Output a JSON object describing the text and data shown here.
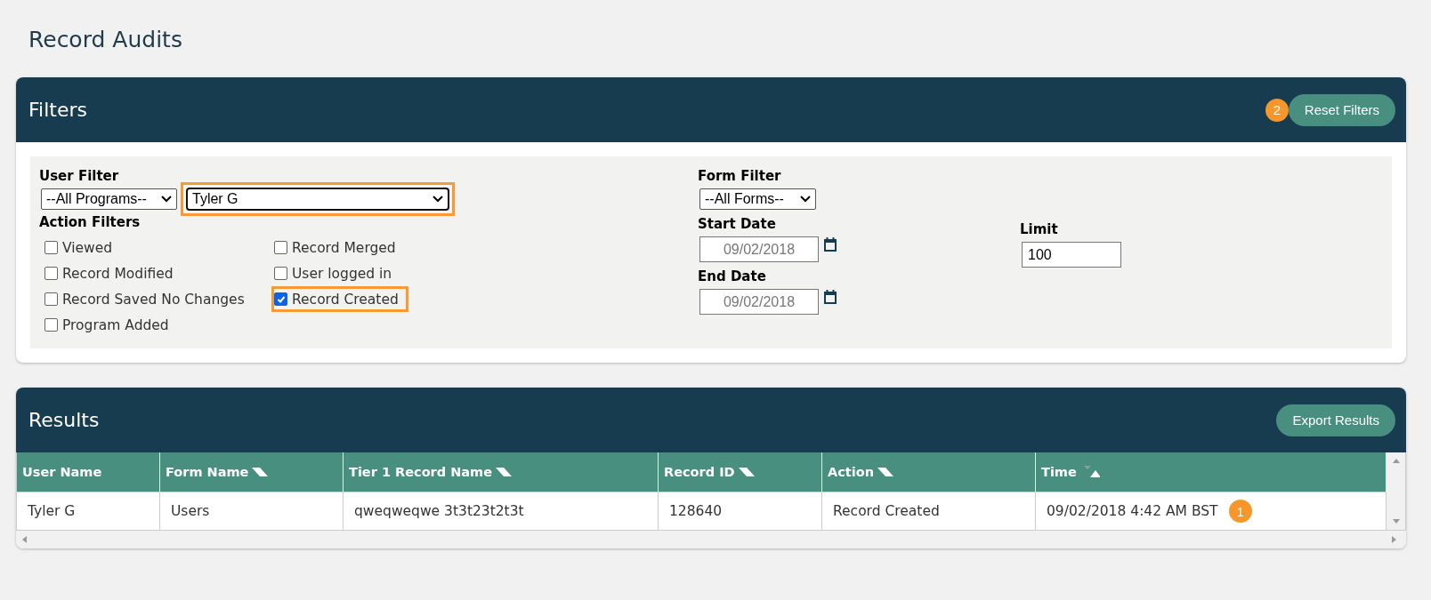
{
  "page_title": "Record Audits",
  "filters": {
    "title": "Filters",
    "badge": "2",
    "reset_button": "Reset Filters",
    "user_filter": {
      "label": "User Filter",
      "program_select": "--All Programs--",
      "user_select": "Tyler G",
      "user_highlighted": true
    },
    "action_filters": {
      "label": "Action Filters",
      "items": [
        {
          "label": "Viewed",
          "checked": false,
          "highlighted": false
        },
        {
          "label": "Record Modified",
          "checked": false,
          "highlighted": false
        },
        {
          "label": "Record Saved No Changes",
          "checked": false,
          "highlighted": false
        },
        {
          "label": "Program Added",
          "checked": false,
          "highlighted": false
        },
        {
          "label": "Record Merged",
          "checked": false,
          "highlighted": false
        },
        {
          "label": "User logged in",
          "checked": false,
          "highlighted": false
        },
        {
          "label": "Record Created",
          "checked": true,
          "highlighted": true
        }
      ]
    },
    "form_filter": {
      "label": "Form Filter",
      "select": "--All Forms--"
    },
    "start_date": {
      "label": "Start Date",
      "placeholder": "09/02/2018"
    },
    "end_date": {
      "label": "End Date",
      "placeholder": "09/02/2018"
    },
    "limit": {
      "label": "Limit",
      "value": "100"
    }
  },
  "results": {
    "title": "Results",
    "export_button": "Export Results",
    "columns": [
      {
        "label": "User Name",
        "sortable": false
      },
      {
        "label": "Form Name",
        "sortable": true,
        "sorted": false
      },
      {
        "label": "Tier 1 Record Name",
        "sortable": true,
        "sorted": false
      },
      {
        "label": "Record ID",
        "sortable": true,
        "sorted": false
      },
      {
        "label": "Action",
        "sortable": true,
        "sorted": false
      },
      {
        "label": "Time",
        "sortable": true,
        "sorted": true
      }
    ],
    "rows": [
      {
        "cells": [
          "Tyler G",
          "Users",
          "qweqweqwe 3t3t23t2t3t",
          "128640",
          "Record Created",
          "09/02/2018 4:42 AM BST"
        ],
        "badge": "1"
      }
    ]
  }
}
